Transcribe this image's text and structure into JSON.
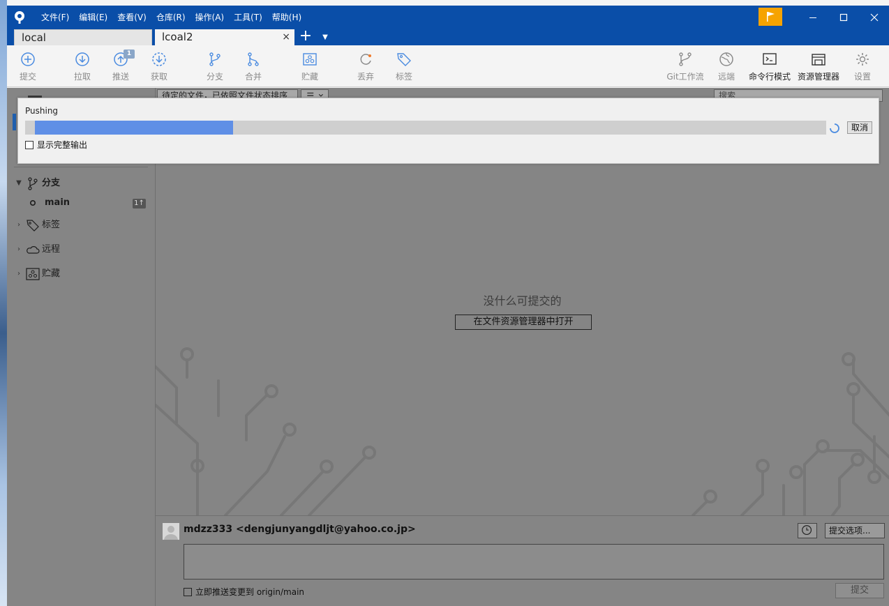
{
  "titlebar": {
    "menu": [
      "文件(F)",
      "编辑(E)",
      "查看(V)",
      "仓库(R)",
      "操作(A)",
      "工具(T)",
      "帮助(H)"
    ]
  },
  "tabs": {
    "items": [
      {
        "label": "local"
      },
      {
        "label": "lcoal2"
      }
    ],
    "close_glyph": "×",
    "add_glyph": "+",
    "more_glyph": "▼"
  },
  "toolbar": {
    "left": [
      {
        "label": "提交",
        "icon": "plus-circle-icon"
      },
      {
        "label": "拉取",
        "icon": "arrow-down-circle-icon"
      },
      {
        "label": "推送",
        "icon": "arrow-up-circle-icon",
        "badge": "1"
      },
      {
        "label": "获取",
        "icon": "arrow-down-dashed-circle-icon"
      },
      {
        "label": "分支",
        "icon": "branch-icon"
      },
      {
        "label": "合并",
        "icon": "merge-icon"
      },
      {
        "label": "贮藏",
        "icon": "stash-icon"
      },
      {
        "label": "丢弃",
        "icon": "discard-icon"
      },
      {
        "label": "标签",
        "icon": "tag-icon"
      }
    ],
    "right": [
      {
        "label": "Git工作流",
        "icon": "git-flow-icon"
      },
      {
        "label": "远端",
        "icon": "globe-icon"
      },
      {
        "label": "命令行模式",
        "icon": "terminal-icon"
      },
      {
        "label": "资源管理器",
        "icon": "explorer-icon"
      },
      {
        "label": "设置",
        "icon": "gear-icon"
      }
    ]
  },
  "sidebar": {
    "branches_label": "分支",
    "current_branch": "main",
    "current_branch_badge": "1↑",
    "tags_label": "标签",
    "remotes_label": "远程",
    "stashes_label": "贮藏"
  },
  "filter": {
    "label": "待定的文件，已依照文件状态排序",
    "search_placeholder": "搜索"
  },
  "content": {
    "empty_message": "没什么可提交的",
    "open_in_explorer": "在文件资源管理器中打开"
  },
  "commit": {
    "author": "mdzz333 <dengjunyangdljt@yahoo.co.jp>",
    "options_label": "提交选项...",
    "push_immediately_label": "立即推送变更到 origin/main",
    "commit_button": "提交"
  },
  "push_dialog": {
    "title": "Pushing",
    "progress": 0.25,
    "cancel_label": "取消",
    "show_output_label": "显示完整输出"
  },
  "colors": {
    "titlebar": "#0a4ea8",
    "flag": "#f6a300",
    "progress_fill": "#5f8fe6",
    "overlay_gray": "#858585"
  }
}
